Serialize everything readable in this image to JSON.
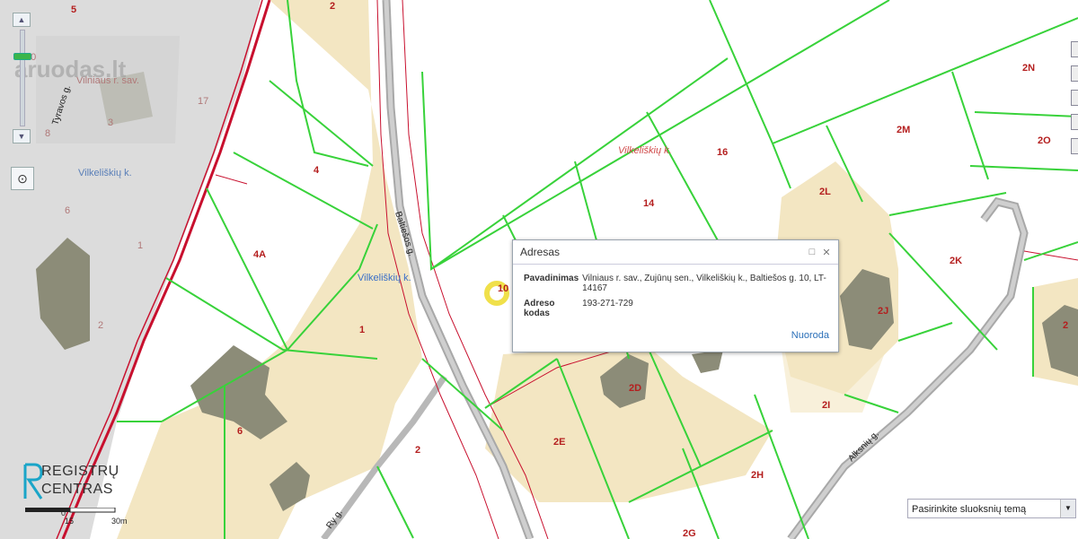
{
  "watermark": "aruodas.lt",
  "map": {
    "parcels_left": [
      "5",
      "2",
      "10",
      "17",
      "3",
      "8",
      "4",
      "6",
      "1",
      "2",
      "4A",
      "1",
      "6",
      "2"
    ],
    "parcels_right": [
      "16",
      "14",
      "2N",
      "2M",
      "2O",
      "2L",
      "2K",
      "2J",
      "2",
      "2D",
      "2I",
      "2E",
      "2H",
      "2G",
      "10"
    ],
    "gray_labels": [
      "Vilniaus r. sav."
    ],
    "places": [
      "Vilkeliškių k.",
      "Vilkeliškių k.",
      "Vilkeliškių k."
    ],
    "streets": [
      "Tyravos g.",
      "Baltiešos g.",
      "Alksnių g.",
      "Ry g."
    ]
  },
  "popup": {
    "title": "Adresas",
    "rows": [
      {
        "key": "Pavadinimas",
        "value": "Vilniaus r. sav., Zujūnų sen., Vilkeliškių k., Baltiešos g. 10, LT-14167"
      },
      {
        "key": "Adreso kodas",
        "value": "193-271-729"
      }
    ],
    "link": "Nuoroda"
  },
  "logo": {
    "line1": "REGISTRŲ",
    "line2": "CENTRAS"
  },
  "scale": {
    "ticks": [
      "0",
      "15",
      "30m"
    ]
  },
  "layer_select": {
    "selected": "Pasirinkite sluoksnių temą"
  },
  "zoom": {
    "level": 0.75
  },
  "icons": [
    "zoom-in-icon",
    "zoom-out-icon",
    "locate-icon",
    "maximize-icon",
    "close-icon",
    "dropdown-arrow-icon"
  ],
  "colors": {
    "parcel_fill": "#f3e6c2",
    "parcel_line": "#38d23a",
    "road": "#a8a8a8",
    "boundary": "#c8102e",
    "building": "#8c8c78"
  }
}
